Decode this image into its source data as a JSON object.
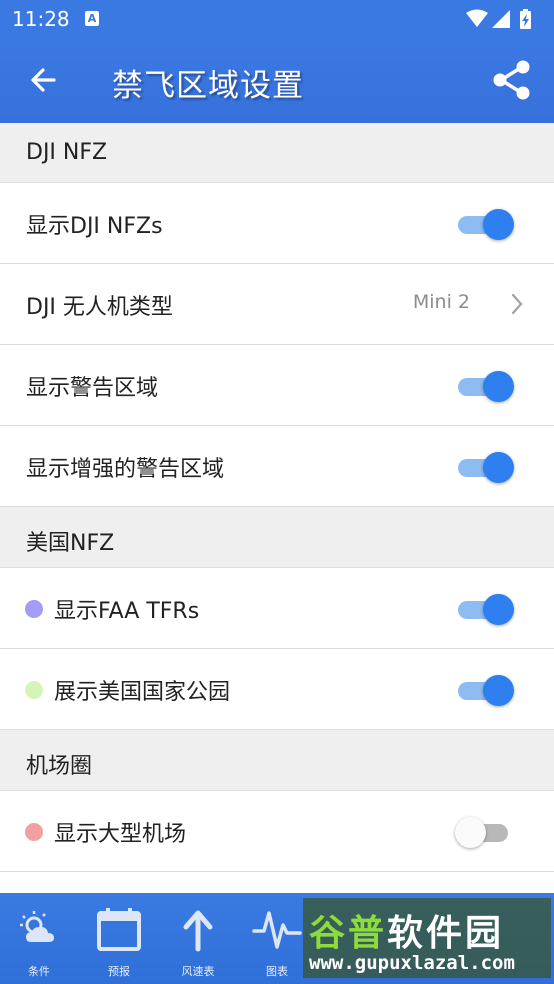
{
  "status_bar": {
    "time": "11:28",
    "notification_icon": "A"
  },
  "app_bar": {
    "title": "禁飞区域设置"
  },
  "sections": [
    {
      "header": "DJI NFZ",
      "items": [
        {
          "label": "显示DJI NFZs",
          "type": "switch",
          "on": true
        },
        {
          "label": "DJI 无人机类型",
          "type": "select",
          "value": "Mini 2"
        },
        {
          "label": "显示警告区域",
          "type": "switch",
          "on": true
        },
        {
          "label": "显示增强的警告区域",
          "type": "switch",
          "on": true
        }
      ]
    },
    {
      "header": "美国NFZ",
      "items": [
        {
          "label": "显示FAA TFRs",
          "type": "switch",
          "on": true,
          "dot_color": "#a59cf5"
        },
        {
          "label": "展示美国国家公园",
          "type": "switch",
          "on": true,
          "dot_color": "#d5f5b8"
        }
      ]
    },
    {
      "header": "机场圈",
      "items": [
        {
          "label": "显示大型机场",
          "type": "switch",
          "on": false,
          "dot_color": "#f5a0a0"
        }
      ]
    }
  ],
  "bottom_nav": [
    {
      "label": "条件",
      "icon": "weather-icon"
    },
    {
      "label": "预报",
      "icon": "calendar-icon"
    },
    {
      "label": "风速表",
      "icon": "arrow-up-icon"
    },
    {
      "label": "图表",
      "icon": "pulse-icon"
    }
  ],
  "watermark": {
    "title_part1": "谷普",
    "title_part2": "软件园",
    "url": "www.gupuxlazal.com"
  },
  "colors": {
    "primary": "#3b79e2",
    "switch_on": "#2e7ff0",
    "switch_track_on": "#8dbcf3",
    "section_bg": "#efefef"
  }
}
